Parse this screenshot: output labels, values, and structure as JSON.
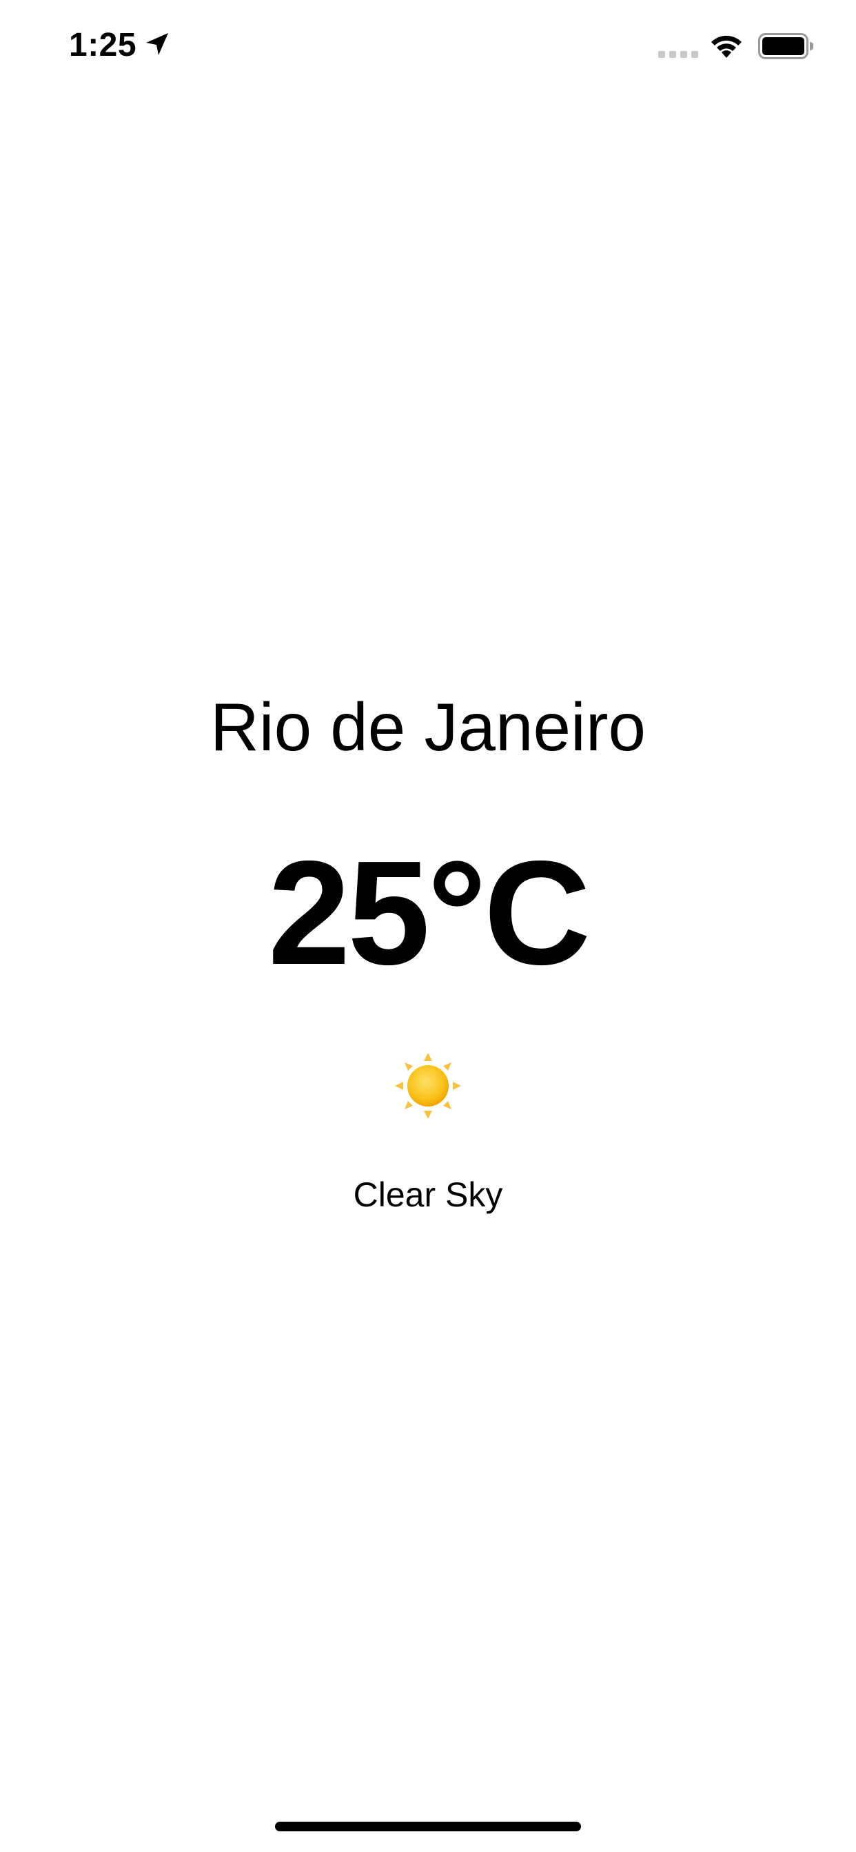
{
  "status_bar": {
    "time": "1:25",
    "icons": [
      "location-arrow-icon",
      "cellular-signal-icon",
      "wifi-icon",
      "battery-icon"
    ]
  },
  "weather": {
    "city": "Rio de Janeiro",
    "temperature": "25°C",
    "condition_icon": "sun-icon",
    "condition": "Clear Sky"
  },
  "colors": {
    "background": "#ffffff",
    "text": "#000000",
    "sun_core": "#f7b500",
    "sun_rays": "#f5c242",
    "inactive_signal": "#c7c7cc"
  }
}
